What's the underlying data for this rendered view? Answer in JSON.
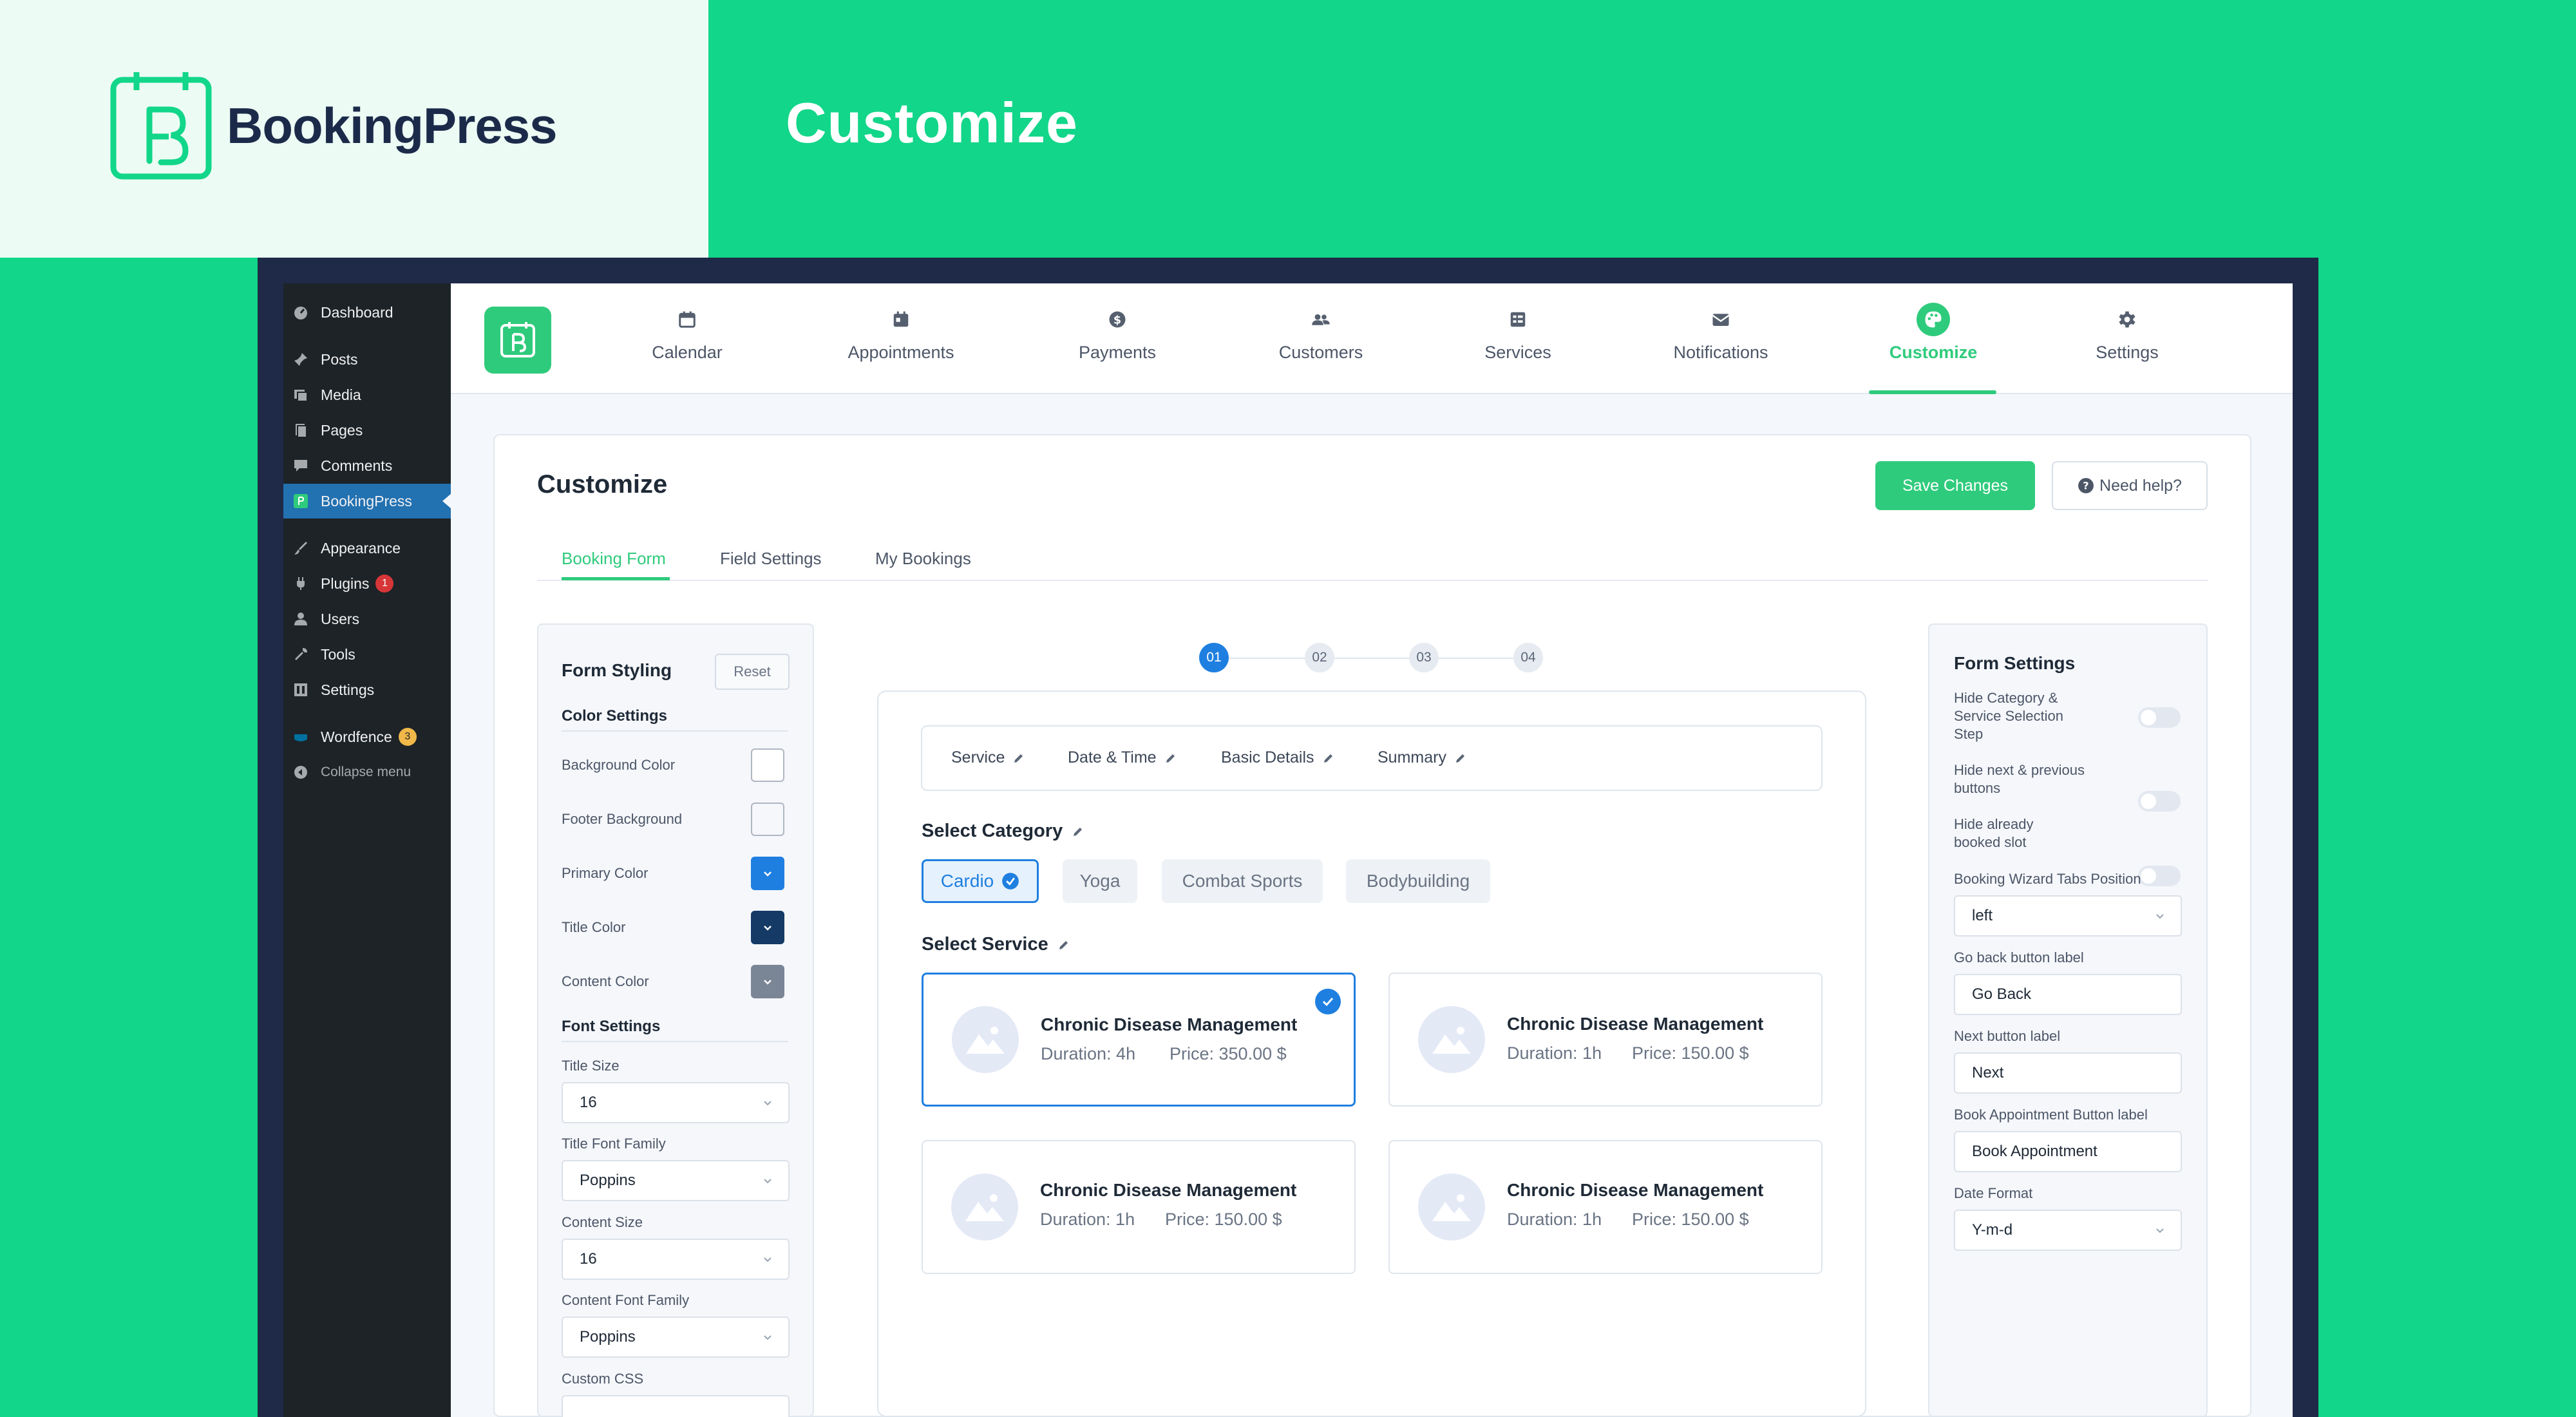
{
  "brand": {
    "name": "BookingPress",
    "hero_title": "Customize",
    "accent": "#2fcb7c"
  },
  "wp_menu": {
    "items": [
      {
        "label": "Dashboard",
        "icon": "dashboard-icon"
      },
      {
        "label": "Posts",
        "icon": "pin-icon"
      },
      {
        "label": "Media",
        "icon": "media-icon"
      },
      {
        "label": "Pages",
        "icon": "pages-icon"
      },
      {
        "label": "Comments",
        "icon": "comment-icon"
      },
      {
        "label": "BookingPress",
        "icon": "bookingpress-icon"
      },
      {
        "label": "Appearance",
        "icon": "brush-icon"
      },
      {
        "label": "Plugins",
        "icon": "plug-icon",
        "badge": "1"
      },
      {
        "label": "Users",
        "icon": "user-icon"
      },
      {
        "label": "Tools",
        "icon": "wrench-icon"
      },
      {
        "label": "Settings",
        "icon": "settings-icon"
      },
      {
        "label": "Wordfence",
        "icon": "wordfence-icon",
        "badge": "3"
      },
      {
        "label": "Collapse menu",
        "icon": "collapse-icon"
      }
    ]
  },
  "nav": {
    "items": [
      {
        "label": "Calendar",
        "icon": "calendar-icon"
      },
      {
        "label": "Appointments",
        "icon": "appointment-icon"
      },
      {
        "label": "Payments",
        "icon": "dollar-icon"
      },
      {
        "label": "Customers",
        "icon": "customers-icon"
      },
      {
        "label": "Services",
        "icon": "services-icon"
      },
      {
        "label": "Notifications",
        "icon": "mail-icon"
      },
      {
        "label": "Customize",
        "icon": "palette-icon",
        "active": true
      },
      {
        "label": "Settings",
        "icon": "gear-icon"
      }
    ]
  },
  "header": {
    "title": "Customize",
    "save_label": "Save Changes",
    "help_label": "Need help?"
  },
  "tabs": [
    {
      "label": "Booking Form",
      "active": true
    },
    {
      "label": "Field Settings"
    },
    {
      "label": "My Bookings"
    }
  ],
  "form_styling": {
    "title": "Form Styling",
    "reset_label": "Reset",
    "color_settings_title": "Color Settings",
    "colors": [
      {
        "label": "Background Color",
        "value": "#ffffff"
      },
      {
        "label": "Footer Background",
        "value": "#f5f7fb"
      },
      {
        "label": "Primary Color",
        "value": "#1f7fe0"
      },
      {
        "label": "Title Color",
        "value": "#163a66"
      },
      {
        "label": "Content Color",
        "value": "#7a8596"
      }
    ],
    "font_settings_title": "Font Settings",
    "fields": [
      {
        "label": "Title Size",
        "value": "16"
      },
      {
        "label": "Title Font Family",
        "value": "Poppins"
      },
      {
        "label": "Content Size",
        "value": "16"
      },
      {
        "label": "Content Font Family",
        "value": "Poppins"
      }
    ],
    "custom_css_label": "Custom CSS"
  },
  "wizard": {
    "steps": [
      "01",
      "02",
      "03",
      "04"
    ],
    "summary_tabs": [
      "Service",
      "Date & Time",
      "Basic Details",
      "Summary"
    ],
    "category_title": "Select Category",
    "categories": [
      {
        "label": "Cardio",
        "active": true
      },
      {
        "label": "Yoga"
      },
      {
        "label": "Combat Sports"
      },
      {
        "label": "Bodybuilding"
      }
    ],
    "service_title": "Select Service",
    "services": [
      {
        "name": "Chronic Disease Management",
        "duration": "Duration: 4h",
        "price": "Price: 350.00 $",
        "selected": true
      },
      {
        "name": "Chronic Disease Management",
        "duration": "Duration: 1h",
        "price": "Price: 150.00 $"
      },
      {
        "name": "Chronic Disease Management",
        "duration": "Duration: 1h",
        "price": "Price: 150.00 $"
      },
      {
        "name": "Chronic Disease Management",
        "duration": "Duration: 1h",
        "price": "Price: 150.00 $"
      }
    ]
  },
  "form_settings": {
    "title": "Form Settings",
    "toggles": [
      {
        "label": "Hide Category & Service Selection Step",
        "on": false
      },
      {
        "label": "Hide next & previous buttons",
        "on": false
      },
      {
        "label": "Hide already booked slot",
        "on": false
      }
    ],
    "wizard_position_label": "Booking Wizard Tabs Position",
    "wizard_position_value": "left",
    "go_back_label": "Go back button label",
    "go_back_value": "Go Back",
    "next_label": "Next button label",
    "next_value": "Next",
    "book_label": "Book Appointment Button label",
    "book_value": "Book Appointment",
    "date_format_label": "Date Format",
    "date_format_value": "Y-m-d"
  }
}
